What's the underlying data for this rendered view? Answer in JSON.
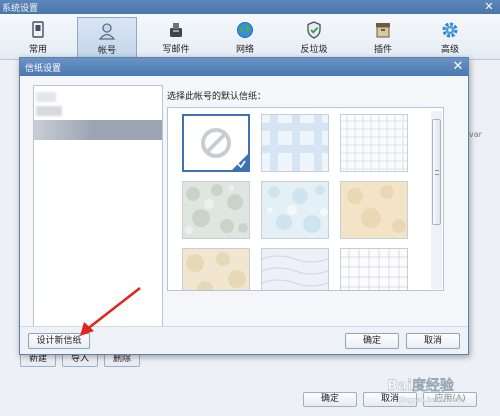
{
  "outer_window": {
    "title": "系统设置",
    "close_glyph": "✕",
    "toolbar": [
      {
        "label": "常用",
        "icon": "settings-sheet-icon",
        "active": false
      },
      {
        "label": "帐号",
        "icon": "user-icon",
        "active": true
      },
      {
        "label": "写邮件",
        "icon": "compose-icon",
        "active": false
      },
      {
        "label": "网络",
        "icon": "globe-icon",
        "active": false
      },
      {
        "label": "反垃圾",
        "icon": "shield-icon",
        "active": false
      },
      {
        "label": "插件",
        "icon": "plugin-box-icon",
        "active": false
      },
      {
        "label": "高级",
        "icon": "gear-icon",
        "active": false
      }
    ],
    "right_edge_text": "var",
    "account_buttons": {
      "new": "新建",
      "import": "导入",
      "delete": "删除"
    },
    "footer_buttons": {
      "ok": "确定",
      "cancel": "取消",
      "apply": "应用(A)"
    }
  },
  "modal": {
    "title": "信纸设置",
    "close_glyph": "✕",
    "prompt": "选择此帐号的默认信纸：",
    "stationery": [
      {
        "name": "none",
        "selected": true
      },
      {
        "name": "light-blue-plaid",
        "selected": false
      },
      {
        "name": "blue-grid",
        "selected": false
      },
      {
        "name": "green-marble",
        "selected": false
      },
      {
        "name": "light-blue-marble",
        "selected": false
      },
      {
        "name": "beige-parchment",
        "selected": false
      },
      {
        "name": "cream-parchment",
        "selected": false
      },
      {
        "name": "lavender-texture",
        "selected": false
      },
      {
        "name": "gray-grid",
        "selected": false
      }
    ],
    "design_button": "设计新信纸",
    "ok_button": "确定",
    "cancel_button": "取消"
  },
  "watermark": {
    "text": "Bai度经验",
    "sub": "jingyan.baidu.com"
  },
  "colors": {
    "accent": "#3f72b1",
    "titlebar": "#4a78b0",
    "arrow": "#e0241b"
  }
}
